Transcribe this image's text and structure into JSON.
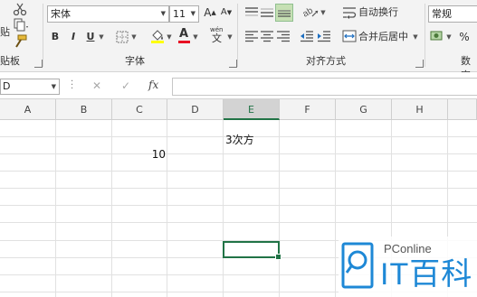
{
  "ribbon": {
    "clipboard": {
      "paste_fragment": "贴",
      "group_label": "贴板"
    },
    "font": {
      "font_name": "宋体",
      "font_size": "11",
      "grow_label": "A",
      "shrink_label": "A",
      "bold": "B",
      "italic": "I",
      "underline": "U",
      "font_color_letter": "A",
      "phonetic_top": "wén",
      "phonetic_bottom": "文",
      "group_label": "字体"
    },
    "alignment": {
      "wrap_text": "自动换行",
      "merge_center": "合并后居中",
      "group_label": "对齐方式"
    },
    "number": {
      "format": "常规",
      "percent": "%",
      "group_label": "数字"
    }
  },
  "formula_bar": {
    "name_box": "D",
    "cancel": "✕",
    "enter": "✓",
    "fx": "fx",
    "value": ""
  },
  "grid": {
    "columns": [
      "A",
      "B",
      "C",
      "D",
      "E",
      "F",
      "G",
      "H"
    ],
    "selected_column": "E",
    "cells": {
      "e_row1": "3次方",
      "c_row2": "10"
    }
  },
  "watermark": {
    "brand_small": "PConline",
    "brand_large": "IT百科"
  },
  "colors": {
    "accent": "#217346",
    "ribbon_bg": "#f3f3f3",
    "font_color_bar": "#e81123",
    "highlight_bar": "#ffff00",
    "watermark_blue": "#1e88d6"
  }
}
